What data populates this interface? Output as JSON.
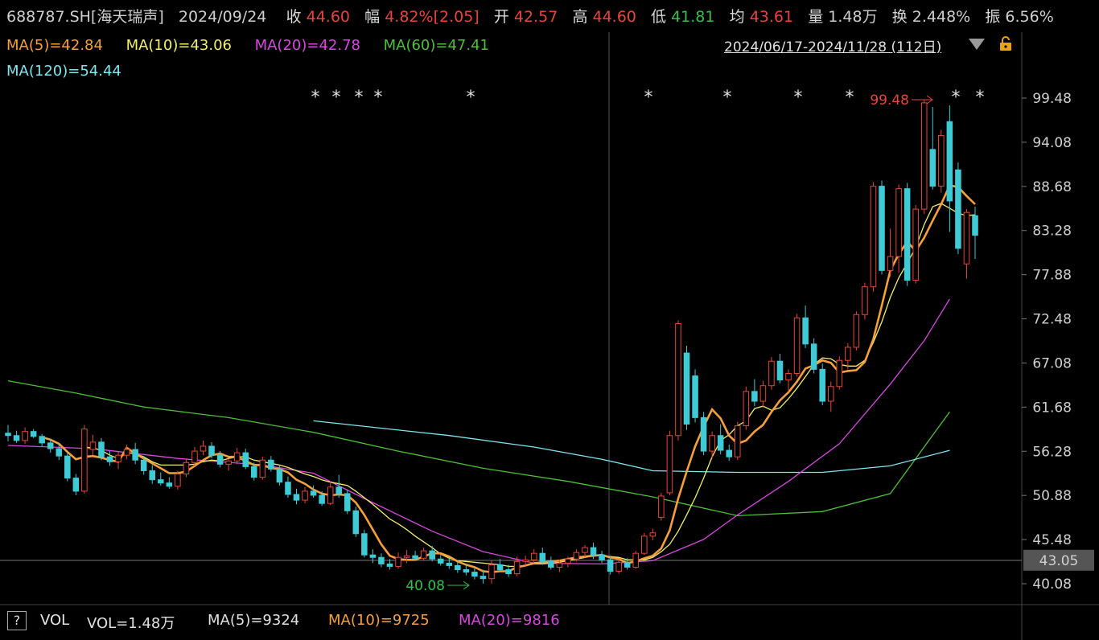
{
  "header": {
    "code": "688787.SH[海天瑞声]",
    "date": "2024/09/24",
    "close_label": "收",
    "close": "44.60",
    "change_label": "幅",
    "change": "4.82%[2.05]",
    "open_label": "开",
    "open": "42.57",
    "high_label": "高",
    "high": "44.60",
    "low_label": "低",
    "low": "41.81",
    "avg_label": "均",
    "avg": "43.61",
    "volume_label": "量",
    "volume": "1.48万",
    "turnover_label": "换",
    "turnover": "2.448%",
    "amplitude_label": "振",
    "amplitude": "6.56%"
  },
  "ma": {
    "ma5": "MA(5)=42.84",
    "ma10": "MA(10)=43.06",
    "ma20": "MA(20)=42.78",
    "ma60": "MA(60)=47.41",
    "ma120": "MA(120)=54.44"
  },
  "range_text": "2024/06/17-2024/11/28 (112日)",
  "help_label": "?",
  "vol_bar": {
    "vol": "VOL",
    "vol_value": "VOL=1.48万",
    "ma5": "MA(5)=9324",
    "ma10": "MA(10)=9725",
    "ma20": "MA(20)=9816"
  },
  "colors": {
    "up": "#e8443a",
    "down": "#3ecbd6",
    "ma5": "#f5a03c",
    "ma10": "#f2f06a",
    "ma20": "#d848e0",
    "ma60": "#4fbf3a",
    "ma120": "#7fe6ef"
  },
  "chart_data": {
    "type": "candlestick",
    "y_ticks": [
      "99.48",
      "94.08",
      "88.68",
      "83.28",
      "77.88",
      "72.48",
      "67.08",
      "61.68",
      "56.28",
      "50.88",
      "45.48",
      "40.08"
    ],
    "ylim": [
      40.08,
      99.48
    ],
    "crosshair_value": "43.05",
    "annotations": {
      "max_label": "99.48",
      "min_label": "40.08"
    },
    "star_marks": [
      "*",
      "*",
      "*",
      "*",
      "**",
      "*",
      "*",
      "*",
      "*",
      "*",
      "*"
    ],
    "candles": [
      [
        58.5,
        59.5,
        57.5,
        58.2
      ],
      [
        58.2,
        58.8,
        57.3,
        57.6
      ],
      [
        57.6,
        59.2,
        57.2,
        58.7
      ],
      [
        58.7,
        59.0,
        57.9,
        58.1
      ],
      [
        58.1,
        58.4,
        56.9,
        57.3
      ],
      [
        57.3,
        57.8,
        56.1,
        56.6
      ],
      [
        56.6,
        57.2,
        55.2,
        55.7
      ],
      [
        55.7,
        56.2,
        52.6,
        53.0
      ],
      [
        53.0,
        53.5,
        50.9,
        51.4
      ],
      [
        51.4,
        59.5,
        51.1,
        59.0
      ],
      [
        56.5,
        58.3,
        55.8,
        57.4
      ],
      [
        57.4,
        57.9,
        55.2,
        55.6
      ],
      [
        55.6,
        56.3,
        54.5,
        55.0
      ],
      [
        55.0,
        56.2,
        54.1,
        55.8
      ],
      [
        55.8,
        57.1,
        55.3,
        56.5
      ],
      [
        56.5,
        57.3,
        54.7,
        55.2
      ],
      [
        55.2,
        55.7,
        53.4,
        53.9
      ],
      [
        53.9,
        54.6,
        52.3,
        52.8
      ],
      [
        52.8,
        53.7,
        52.1,
        52.4
      ],
      [
        52.4,
        53.1,
        51.7,
        52.0
      ],
      [
        52.0,
        53.9,
        51.6,
        53.5
      ],
      [
        53.5,
        55.4,
        53.1,
        54.9
      ],
      [
        54.9,
        56.8,
        54.5,
        56.3
      ],
      [
        56.3,
        57.6,
        55.8,
        56.9
      ],
      [
        56.9,
        57.4,
        55.4,
        55.8
      ],
      [
        55.8,
        56.3,
        54.3,
        54.7
      ],
      [
        54.7,
        55.4,
        53.9,
        55.1
      ],
      [
        55.1,
        56.7,
        54.7,
        56.1
      ],
      [
        56.1,
        56.6,
        54.1,
        54.4
      ],
      [
        54.4,
        54.9,
        52.7,
        53.1
      ],
      [
        53.1,
        55.6,
        52.8,
        55.2
      ],
      [
        55.2,
        55.7,
        53.8,
        54.1
      ],
      [
        54.1,
        54.6,
        52.1,
        52.5
      ],
      [
        52.5,
        53.2,
        50.6,
        51.0
      ],
      [
        51.0,
        51.7,
        49.8,
        50.3
      ],
      [
        50.3,
        51.9,
        49.9,
        51.4
      ],
      [
        51.4,
        52.1,
        50.6,
        50.9
      ],
      [
        50.9,
        51.4,
        49.6,
        49.9
      ],
      [
        49.9,
        52.6,
        49.7,
        51.9
      ],
      [
        51.9,
        53.4,
        50.6,
        51.1
      ],
      [
        51.1,
        51.6,
        48.6,
        49.0
      ],
      [
        49.0,
        49.5,
        45.8,
        46.2
      ],
      [
        46.2,
        46.7,
        43.3,
        43.6
      ],
      [
        43.6,
        44.3,
        42.6,
        43.3
      ],
      [
        43.3,
        43.8,
        42.1,
        42.5
      ],
      [
        42.5,
        43.1,
        41.8,
        42.2
      ],
      [
        42.2,
        43.9,
        41.9,
        43.3
      ],
      [
        43.3,
        44.2,
        42.6,
        43.5
      ],
      [
        43.5,
        44.1,
        42.9,
        43.2
      ],
      [
        43.2,
        44.5,
        42.9,
        44.1
      ],
      [
        44.1,
        44.7,
        42.8,
        43.1
      ],
      [
        43.1,
        43.6,
        42.3,
        42.6
      ],
      [
        42.6,
        43.2,
        41.9,
        42.3
      ],
      [
        42.3,
        42.9,
        41.4,
        41.8
      ],
      [
        41.8,
        42.5,
        41.1,
        41.5
      ],
      [
        41.5,
        42.1,
        40.6,
        41.0
      ],
      [
        41.0,
        41.8,
        40.1,
        40.7
      ],
      [
        40.7,
        42.9,
        40.1,
        42.4
      ],
      [
        42.4,
        43.1,
        41.5,
        41.8
      ],
      [
        41.8,
        42.4,
        40.9,
        41.3
      ],
      [
        41.3,
        43.4,
        41.0,
        42.8
      ],
      [
        42.8,
        43.5,
        42.3,
        43.0
      ],
      [
        43.0,
        44.3,
        42.6,
        43.8
      ],
      [
        43.8,
        44.5,
        42.4,
        42.8
      ],
      [
        42.8,
        43.4,
        41.8,
        42.1
      ],
      [
        42.1,
        43.0,
        41.5,
        42.6
      ],
      [
        42.6,
        43.4,
        42.1,
        43.1
      ],
      [
        43.1,
        44.3,
        42.8,
        43.9
      ],
      [
        43.9,
        44.8,
        43.3,
        44.5
      ],
      [
        44.5,
        45.1,
        43.1,
        43.6
      ],
      [
        43.6,
        44.1,
        42.6,
        43.0
      ],
      [
        43.0,
        43.5,
        41.2,
        41.6
      ],
      [
        41.6,
        43.1,
        41.3,
        42.7
      ],
      [
        42.7,
        43.2,
        41.8,
        42.1
      ],
      [
        42.1,
        44.1,
        41.9,
        43.8
      ],
      [
        43.8,
        46.3,
        43.6,
        45.9
      ],
      [
        45.9,
        46.8,
        45.4,
        46.3
      ],
      [
        48.2,
        51.2,
        47.8,
        50.8
      ],
      [
        51.2,
        58.8,
        50.9,
        58.2
      ],
      [
        58.2,
        72.3,
        57.6,
        71.9
      ],
      [
        68.3,
        69.2,
        58.9,
        59.6
      ],
      [
        65.5,
        66.3,
        59.8,
        60.4
      ],
      [
        60.4,
        61.1,
        55.8,
        56.3
      ],
      [
        56.3,
        58.7,
        55.4,
        58.2
      ],
      [
        58.2,
        59.6,
        55.9,
        56.4
      ],
      [
        56.4,
        57.1,
        55.1,
        55.6
      ],
      [
        55.6,
        59.9,
        55.2,
        59.4
      ],
      [
        59.4,
        64.2,
        58.9,
        63.6
      ],
      [
        63.6,
        65.1,
        61.8,
        62.4
      ],
      [
        62.4,
        64.9,
        61.6,
        64.3
      ],
      [
        64.3,
        67.8,
        63.8,
        67.3
      ],
      [
        67.3,
        68.2,
        64.6,
        65.0
      ],
      [
        65.0,
        66.3,
        63.6,
        65.8
      ],
      [
        65.8,
        73.1,
        65.4,
        72.6
      ],
      [
        72.6,
        74.1,
        68.9,
        69.4
      ],
      [
        69.4,
        70.1,
        65.8,
        66.3
      ],
      [
        66.3,
        67.0,
        61.9,
        62.4
      ],
      [
        62.4,
        64.8,
        61.1,
        64.2
      ],
      [
        64.2,
        67.9,
        63.8,
        67.4
      ],
      [
        67.4,
        69.5,
        66.3,
        69.0
      ],
      [
        69.0,
        73.4,
        68.6,
        73.0
      ],
      [
        73.0,
        76.9,
        72.4,
        76.4
      ],
      [
        76.4,
        89.2,
        75.8,
        88.7
      ],
      [
        88.7,
        89.4,
        77.9,
        78.4
      ],
      [
        78.4,
        83.5,
        77.6,
        80.1
      ],
      [
        80.1,
        88.9,
        78.1,
        88.4
      ],
      [
        88.4,
        89.1,
        76.5,
        77.2
      ],
      [
        77.2,
        86.4,
        76.8,
        85.9
      ],
      [
        85.9,
        99.3,
        85.3,
        98.9
      ],
      [
        93.2,
        98.4,
        88.3,
        88.7
      ],
      [
        88.7,
        95.6,
        87.9,
        94.9
      ],
      [
        96.6,
        98.6,
        83.1,
        86.9
      ],
      [
        90.7,
        91.6,
        80.4,
        81.1
      ],
      [
        79.2,
        85.9,
        77.4,
        85.5
      ],
      [
        85.1,
        86.2,
        79.8,
        82.7
      ]
    ],
    "ma5": [
      null,
      null,
      null,
      null,
      58.0,
      57.7,
      57.2,
      56.2,
      55.3,
      55.6,
      55.7,
      55.5,
      55.2,
      55.0,
      56.7,
      56.0,
      55.4,
      54.8,
      54.2,
      53.6,
      53.6,
      53.8,
      54.5,
      55.2,
      55.8,
      56.0,
      55.6,
      55.6,
      55.1,
      54.6,
      54.6,
      54.2,
      54.1,
      53.7,
      52.8,
      52.3,
      51.6,
      51.1,
      50.9,
      51.0,
      50.9,
      50.0,
      48.5,
      46.7,
      44.9,
      43.5,
      43.1,
      43.0,
      43.0,
      43.4,
      43.8,
      43.8,
      43.4,
      42.8,
      42.4,
      42.1,
      41.6,
      41.5,
      41.6,
      41.6,
      42.1,
      42.3,
      42.6,
      42.7,
      42.8,
      42.9,
      43.1,
      43.3,
      43.4,
      43.5,
      43.6,
      43.3,
      43.1,
      42.6,
      42.8,
      43.2,
      43.5,
      44.4,
      46.6,
      50.5,
      53.8,
      56.9,
      59.3,
      61.4,
      60.3,
      58.2,
      57.2,
      57.6,
      58.7,
      59.5,
      61.1,
      62.5,
      63.5,
      64.8,
      66.4,
      66.8,
      67.4,
      67.1,
      65.9,
      66.1,
      66.2,
      67.2,
      70.0,
      74.1,
      78.4,
      80.4,
      81.9,
      80.8,
      82.4,
      84.5,
      86.5,
      88.8,
      88.6,
      87.5,
      86.5
    ],
    "ma10": [
      null,
      null,
      null,
      null,
      null,
      null,
      null,
      null,
      null,
      56.8,
      56.7,
      56.4,
      55.8,
      55.4,
      56.1,
      56.0,
      55.6,
      55.0,
      54.6,
      54.6,
      54.6,
      54.6,
      54.7,
      55.0,
      55.2,
      55.1,
      55.4,
      55.6,
      55.6,
      55.2,
      55.0,
      54.8,
      54.6,
      54.3,
      53.9,
      53.5,
      53.2,
      52.8,
      52.5,
      52.3,
      52.1,
      51.4,
      50.6,
      49.8,
      48.9,
      48.0,
      47.4,
      46.7,
      45.9,
      45.2,
      44.5,
      43.7,
      43.2,
      42.9,
      42.8,
      42.7,
      42.6,
      42.5,
      42.4,
      42.2,
      42.2,
      42.3,
      42.5,
      42.5,
      42.6,
      42.7,
      42.9,
      43.1,
      43.3,
      43.5,
      43.5,
      43.4,
      43.3,
      43.0,
      43.0,
      43.0,
      43.3,
      44.0,
      44.9,
      46.5,
      48.5,
      50.6,
      53.0,
      55.6,
      57.6,
      58.3,
      59.4,
      60.0,
      61.5,
      61.8,
      61.3,
      61.6,
      62.7,
      64.0,
      65.4,
      66.9,
      67.7,
      67.6,
      66.9,
      66.7,
      66.7,
      67.4,
      69.6,
      72.1,
      75.1,
      77.5,
      79.3,
      81.2,
      84.0,
      86.2,
      86.6,
      86.0,
      85.4,
      85.1,
      85.2
    ]
  }
}
